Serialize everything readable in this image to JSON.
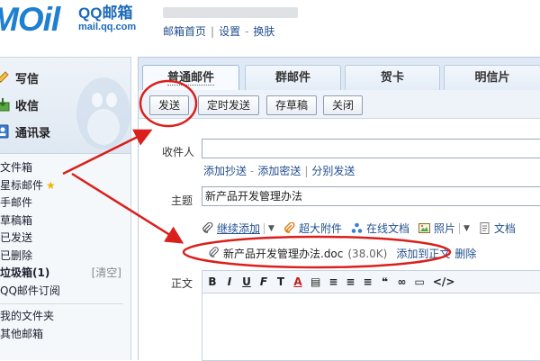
{
  "header": {
    "logo_text": "MOil",
    "brand_name": "QQ邮箱",
    "brand_url": "mail.qq.com",
    "nav": [
      "邮箱首页",
      "设置",
      "换肤"
    ]
  },
  "sidebar": {
    "actions": [
      {
        "label": "写信",
        "icon": "pencil-icon"
      },
      {
        "label": "收信",
        "icon": "inbox-icon"
      },
      {
        "label": "通讯录",
        "icon": "contacts-icon"
      }
    ],
    "folders": [
      {
        "label": "文件箱",
        "bold": false
      },
      {
        "label": "星标邮件",
        "bold": false,
        "star": "★"
      },
      {
        "label": "手邮件",
        "bold": false
      },
      {
        "label": "草稿箱",
        "bold": false
      },
      {
        "label": "已发送",
        "bold": false
      },
      {
        "label": "已删除",
        "bold": false
      },
      {
        "label": "垃圾箱(1)",
        "bold": true,
        "clear_label": "[清空]"
      },
      {
        "label": "QQ邮件订阅",
        "bold": false
      }
    ],
    "bottom_folders": [
      "我的文件夹",
      "其他邮箱"
    ]
  },
  "main": {
    "tabs": [
      "普通邮件",
      "群邮件",
      "贺卡",
      "明信片"
    ],
    "toolbar": {
      "send": "发送",
      "scheduled_send": "定时发送",
      "save_draft": "存草稿",
      "close": "关闭"
    },
    "recipient_label": "收件人",
    "recipient_value": "",
    "cc_links": [
      "添加抄送",
      "添加密送",
      "分别发送"
    ],
    "subject_label": "主题",
    "subject_value": "新产品开发管理办法",
    "attach_bar": [
      "继续添加",
      "超大附件",
      "在线文档",
      "照片",
      "文档"
    ],
    "attachment": {
      "filename": "新产品开发管理办法.doc",
      "size": "(38.0K)",
      "add_to": "添加到正文",
      "delete": "删除"
    },
    "body_label": "正文",
    "editor_tools": [
      "B",
      "I",
      "U",
      "F",
      "T",
      "A",
      "▤",
      "≡",
      "≡",
      "≡",
      "❝",
      "∞",
      "▭",
      "</>"
    ]
  },
  "colors": {
    "brand_blue": "#1c6ab8",
    "annotation_red": "#d9201c",
    "link_blue": "#224f8f"
  }
}
